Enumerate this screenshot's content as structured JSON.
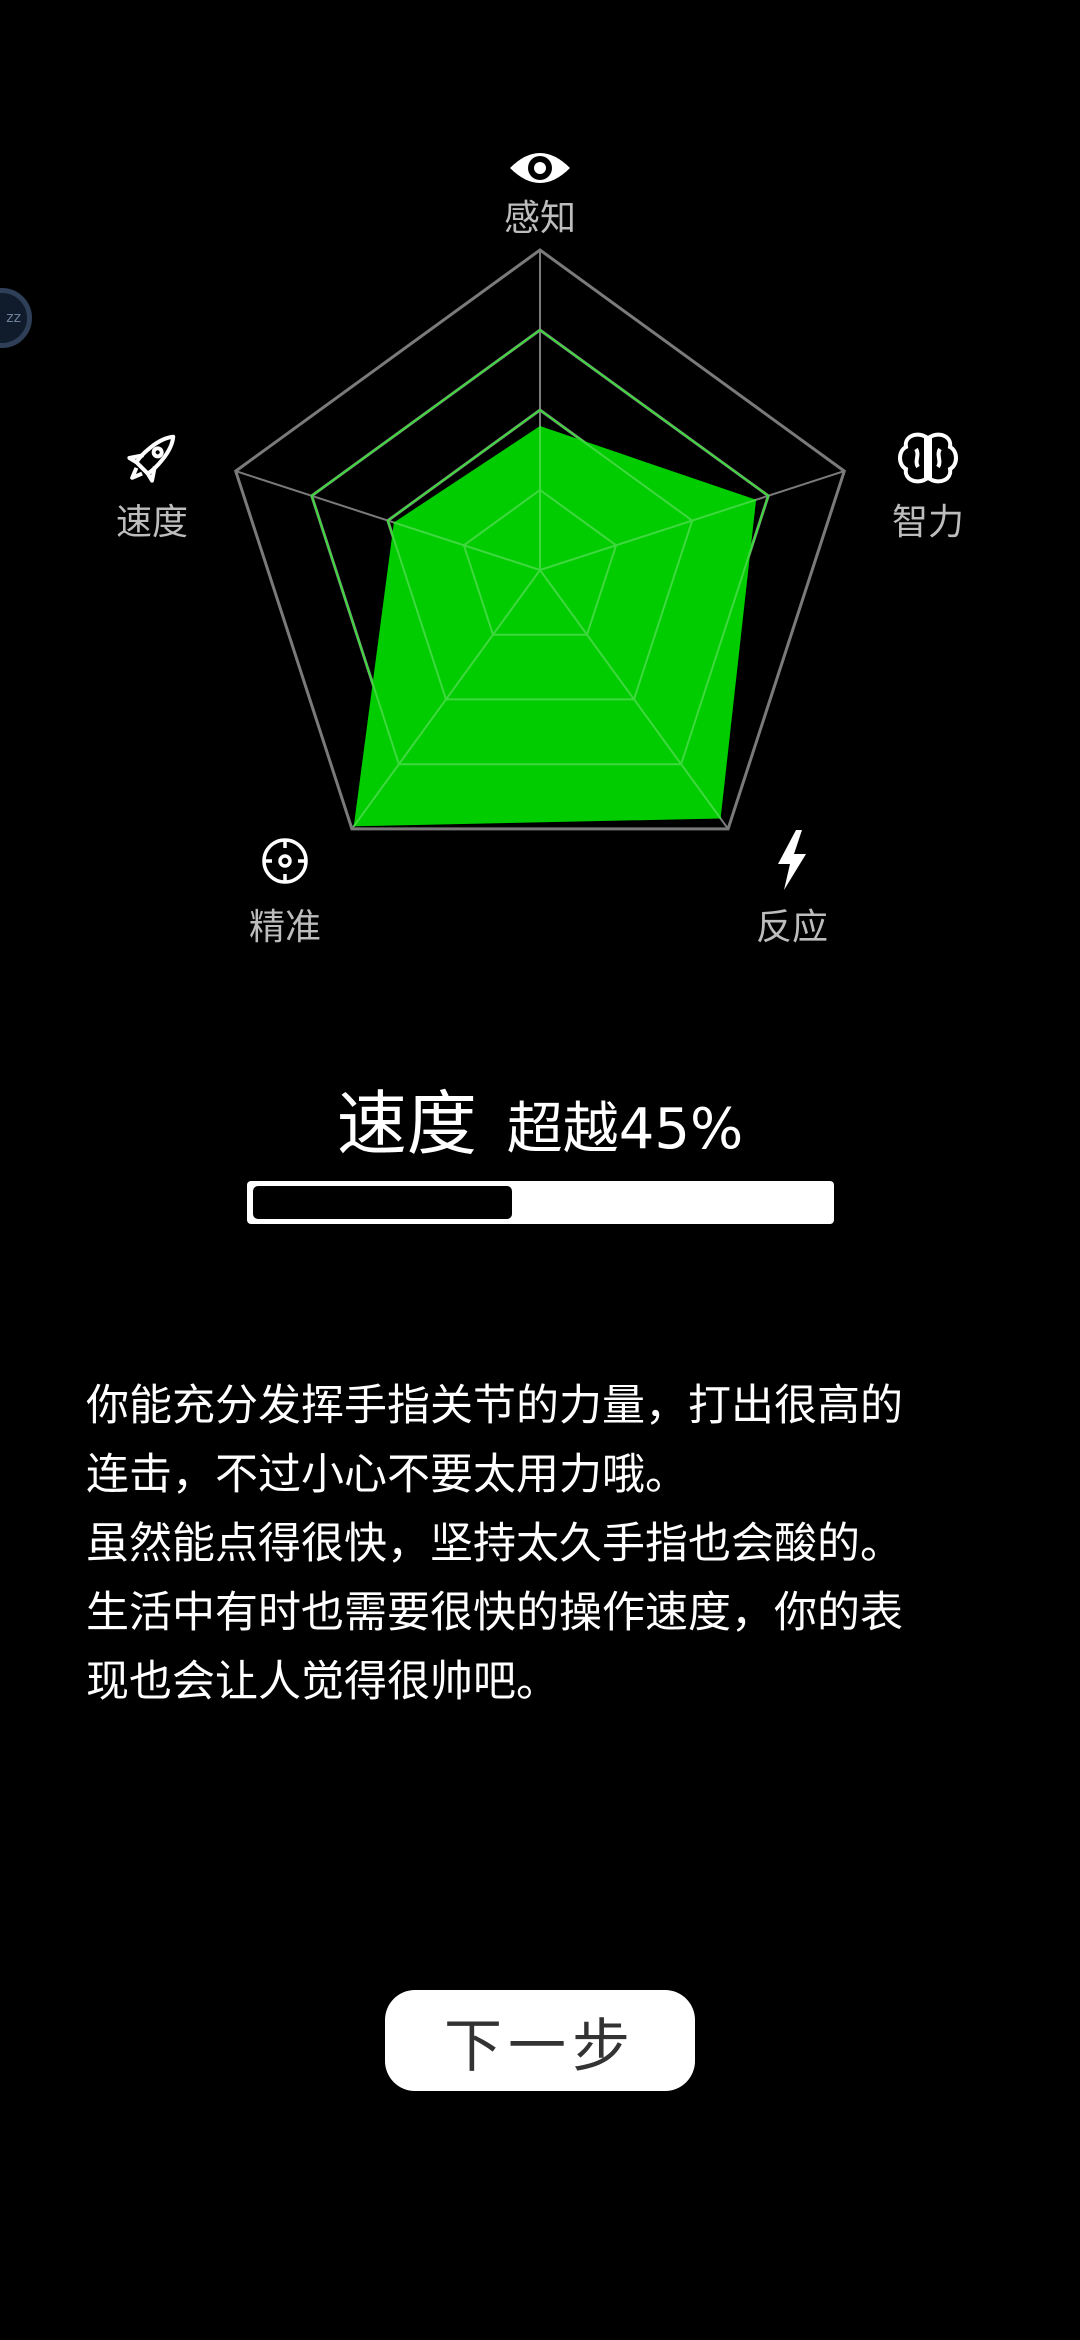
{
  "radar": {
    "axes": [
      {
        "key": "perception",
        "label": "感知",
        "icon": "eye-icon",
        "value": 0.45
      },
      {
        "key": "intelligence",
        "label": "智力",
        "icon": "brain-icon",
        "value": 0.71
      },
      {
        "key": "reaction",
        "label": "反应",
        "icon": "lightning-icon",
        "value": 0.96
      },
      {
        "key": "precision",
        "label": "精准",
        "icon": "crosshair-icon",
        "value": 0.99
      },
      {
        "key": "speed",
        "label": "速度",
        "icon": "rocket-icon",
        "value": 0.48
      }
    ],
    "levels": 4,
    "fill_color": "#00cc00",
    "grid_color": "#7a7a7a",
    "inner_grid_color": "#3fd83f"
  },
  "result": {
    "category": "速度",
    "percentile_text": "超越45%",
    "progress": 0.45
  },
  "description": [
    "你能充分发挥手指关节的力量，打出很高的",
    "连击，不过小心不要太用力哦。",
    "虽然能点得很快，坚持太久手指也会酸的。",
    "生活中有时也需要很快的操作速度，你的表",
    "现也会让人觉得很帅吧。"
  ],
  "float_bubble": {
    "text": "zz"
  },
  "next_button": {
    "label": "下一步"
  }
}
